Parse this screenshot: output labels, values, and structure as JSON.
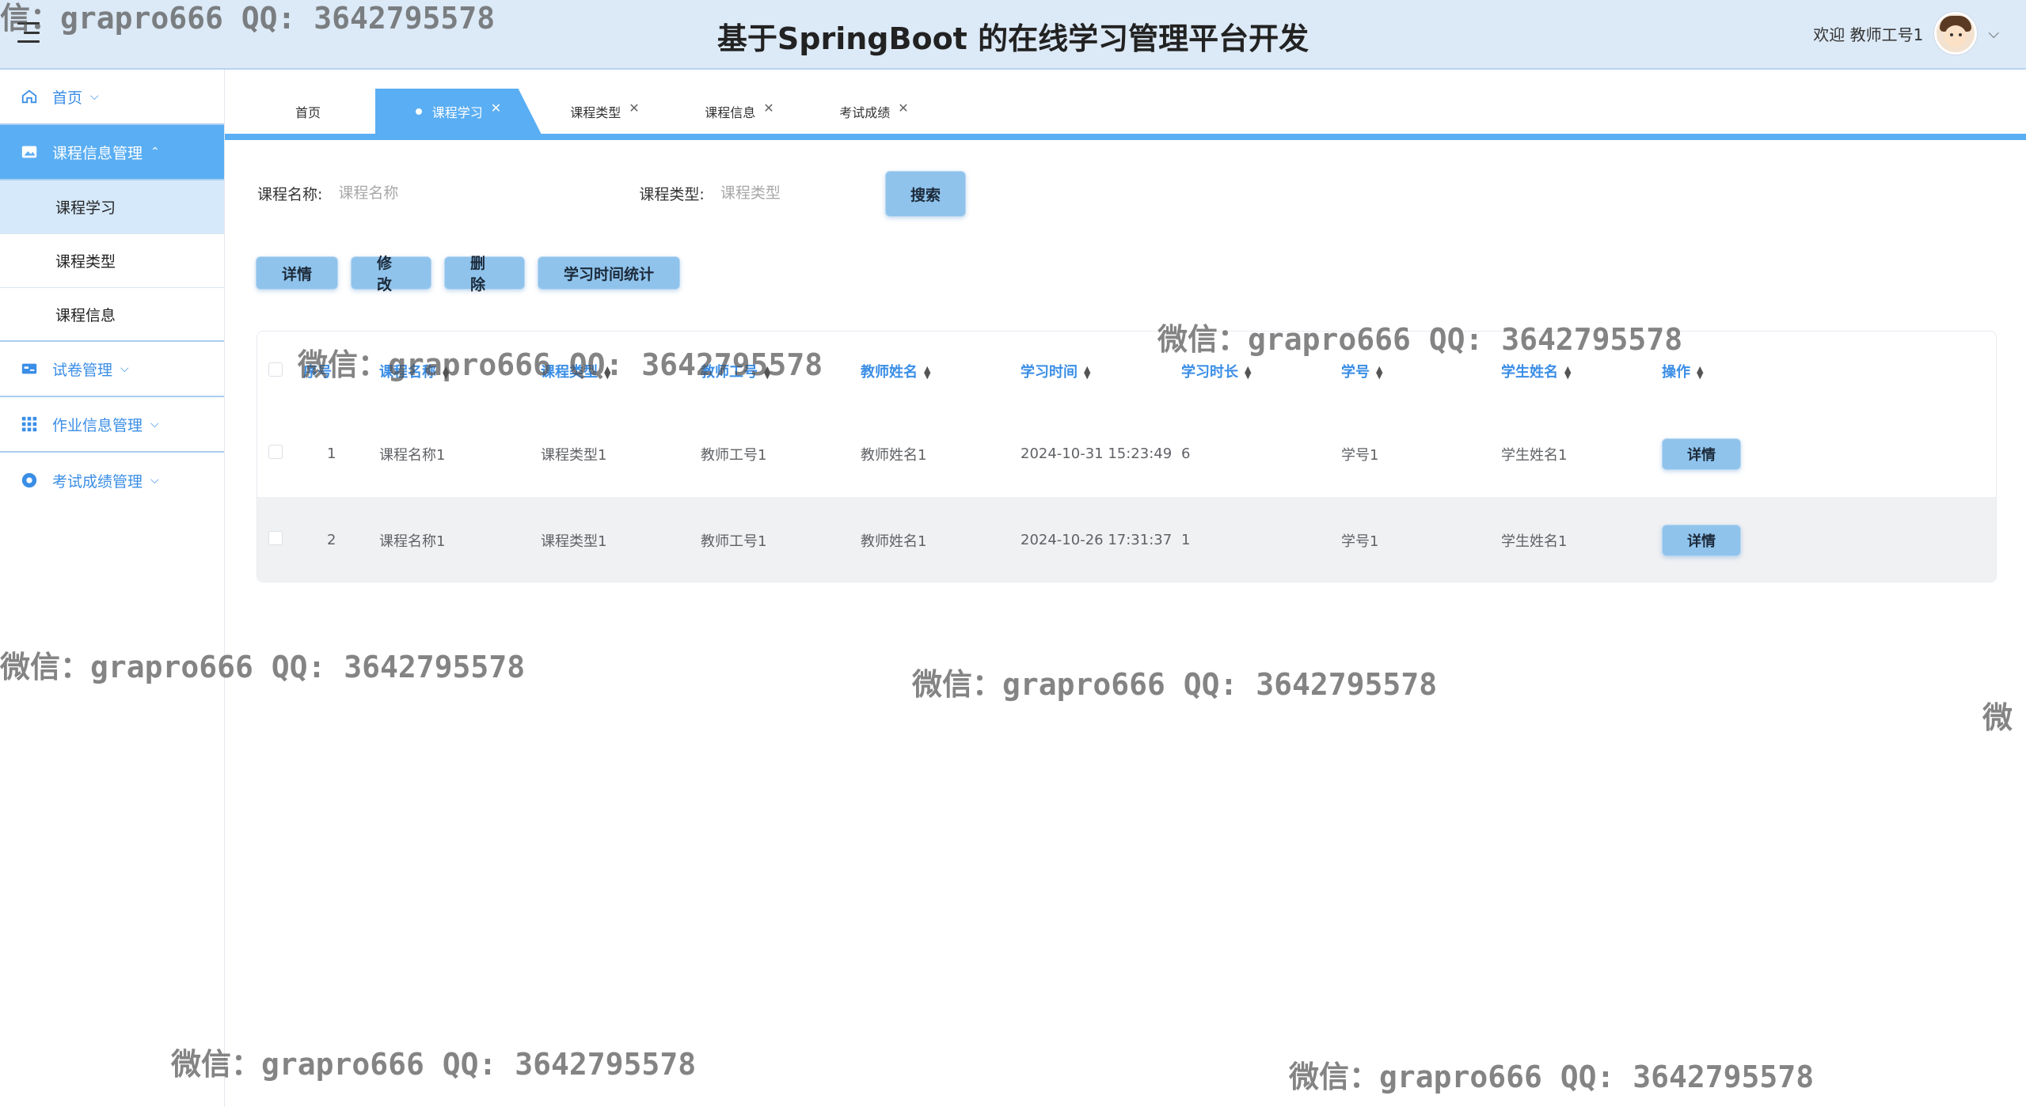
{
  "header": {
    "title": "基于SpringBoot 的在线学习管理平台开发",
    "welcome": "欢迎 教师工号1"
  },
  "sidebar": {
    "items": [
      {
        "label": "首页",
        "icon": "home-icon"
      },
      {
        "label": "课程信息管理",
        "icon": "image-icon",
        "active": true,
        "children": [
          {
            "label": "课程学习",
            "selected": true
          },
          {
            "label": "课程类型"
          },
          {
            "label": "课程信息"
          }
        ]
      },
      {
        "label": "试卷管理",
        "icon": "card-icon"
      },
      {
        "label": "作业信息管理",
        "icon": "grid-icon"
      },
      {
        "label": "考试成绩管理",
        "icon": "circle-icon"
      }
    ]
  },
  "tabs": [
    {
      "label": "首页",
      "closable": false
    },
    {
      "label": "课程学习",
      "closable": true,
      "active": true
    },
    {
      "label": "课程类型",
      "closable": true
    },
    {
      "label": "课程信息",
      "closable": true
    },
    {
      "label": "考试成绩",
      "closable": true
    }
  ],
  "search": {
    "course_name_label": "课程名称:",
    "course_name_placeholder": "课程名称",
    "course_type_label": "课程类型:",
    "course_type_placeholder": "课程类型",
    "search_button": "搜索"
  },
  "actions": {
    "detail": "详情",
    "edit": "修改",
    "delete": "删除",
    "stats": "学习时间统计"
  },
  "table": {
    "columns": [
      "序号",
      "课程名称",
      "课程类型",
      "教师工号",
      "教师姓名",
      "学习时间",
      "学习时长",
      "学号",
      "学生姓名",
      "操作"
    ],
    "rows": [
      {
        "index": "1",
        "course_name": "课程名称1",
        "course_type": "课程类型1",
        "teacher_no": "教师工号1",
        "teacher_name": "教师姓名1",
        "study_time": "2024-10-31 15:23:49",
        "duration": "6",
        "student_no": "学号1",
        "student_name": "学生姓名1",
        "op": "详情"
      },
      {
        "index": "2",
        "course_name": "课程名称1",
        "course_type": "课程类型1",
        "teacher_no": "教师工号1",
        "teacher_name": "教师姓名1",
        "study_time": "2024-10-26 17:31:37",
        "duration": "1",
        "student_no": "学号1",
        "student_name": "学生姓名1",
        "op": "详情"
      }
    ]
  },
  "watermarks": {
    "w0": "信：grapro666 QQ: 3642795578",
    "w1": "微信：grapro666 QQ: 3642795578",
    "w2": "微信：grapro666 QQ: 3642795578",
    "w3": "微信：grapro666 QQ: 3642795578",
    "w4": "微信：grapro666 QQ: 3642795578",
    "w5": "微信：grapro666 QQ: 3642795578",
    "w6": "微信：grapro666 QQ: 3642795578",
    "w7": "微"
  }
}
